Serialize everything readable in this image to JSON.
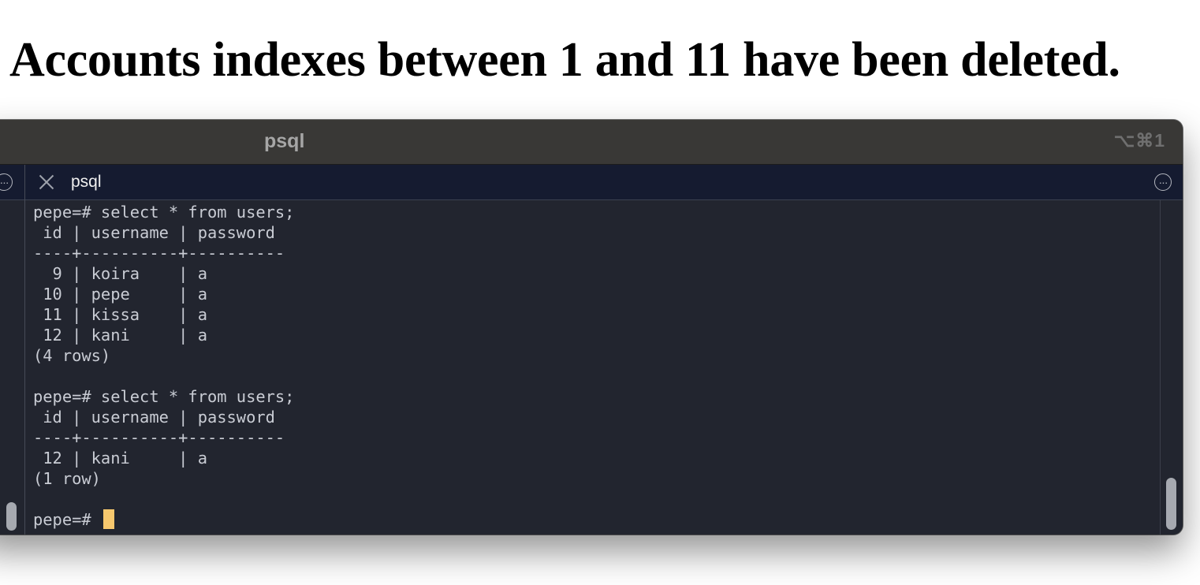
{
  "heading": "Accounts indexes between 1 and 11 have been deleted.",
  "window": {
    "title": "psql",
    "shortcut": "⌥⌘1"
  },
  "tab": {
    "label": "psql"
  },
  "terminal": {
    "lines": [
      "pepe=# select * from users;",
      " id | username | password",
      "----+----------+----------",
      "  9 | koira    | a",
      " 10 | pepe     | a",
      " 11 | kissa    | a",
      " 12 | kani     | a",
      "(4 rows)",
      "",
      "pepe=# select * from users;",
      " id | username | password",
      "----+----------+----------",
      " 12 | kani     | a",
      "(1 row)",
      "",
      "pepe=# "
    ]
  },
  "colors": {
    "terminal_bg": "#22252f",
    "tabbar_bg": "#151b30",
    "titlebar_bg": "#393836",
    "cursor": "#f7c86e"
  },
  "icons": {
    "tab_close": "close-icon",
    "pane_menu": "more-icon",
    "tab_menu": "more-icon"
  }
}
